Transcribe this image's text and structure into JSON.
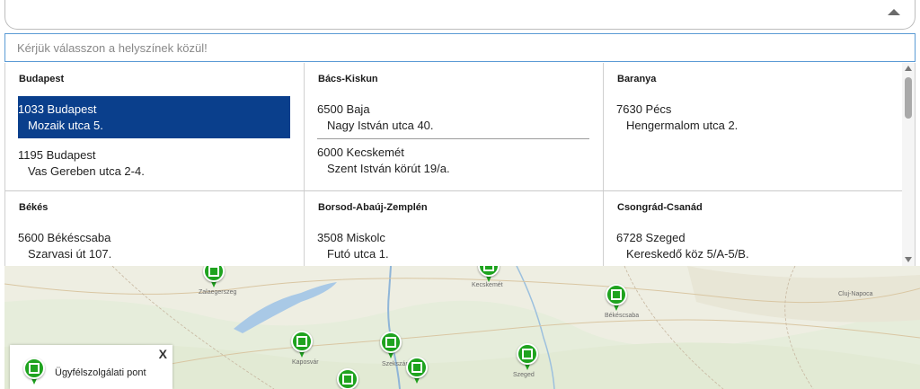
{
  "search": {
    "placeholder": "Kérjük válasszon a helyszínek közül!"
  },
  "regions": [
    {
      "name": "Budapest",
      "offices": [
        {
          "city": "1033 Budapest",
          "street": "Mozaik utca 5.",
          "selected": true
        },
        {
          "city": "1195 Budapest",
          "street": "Vas Gereben utca 2-4.",
          "selected": false
        }
      ]
    },
    {
      "name": "Bács-Kiskun",
      "offices": [
        {
          "city": "6500 Baja",
          "street": "Nagy István utca 40.",
          "selected": false
        },
        {
          "city": "6000 Kecskemét",
          "street": "Szent István körút 19/a.",
          "selected": false
        }
      ]
    },
    {
      "name": "Baranya",
      "offices": [
        {
          "city": "7630 Pécs",
          "street": "Hengermalom utca 2.",
          "selected": false
        }
      ]
    },
    {
      "name": "Békés",
      "offices": [
        {
          "city": "5600 Békéscsaba",
          "street": "Szarvasi út 107.",
          "selected": false
        }
      ]
    },
    {
      "name": "Borsod-Abaúj-Zemplén",
      "offices": [
        {
          "city": "3508 Miskolc",
          "street": "Futó utca 1.",
          "selected": false
        }
      ]
    },
    {
      "name": "Csongrád-Csanád",
      "offices": [
        {
          "city": "6728 Szeged",
          "street": "Kereskedő köz 5/A-5/B.",
          "selected": false
        }
      ]
    }
  ],
  "map": {
    "labels": [
      "Zalaegerszeg",
      "Kaposvár",
      "Szekszárd",
      "Kecskemét",
      "Békéscsaba",
      "Szeged",
      "Cluj-Napoca"
    ]
  },
  "legend": {
    "close_label": "X",
    "item_label": "Ügyfélszolgálati pont",
    "icon": "location-pin-icon"
  },
  "colors": {
    "selected_bg": "#0a3f8c",
    "pin": "#1fa31f",
    "input_border": "#5b9bd5"
  }
}
